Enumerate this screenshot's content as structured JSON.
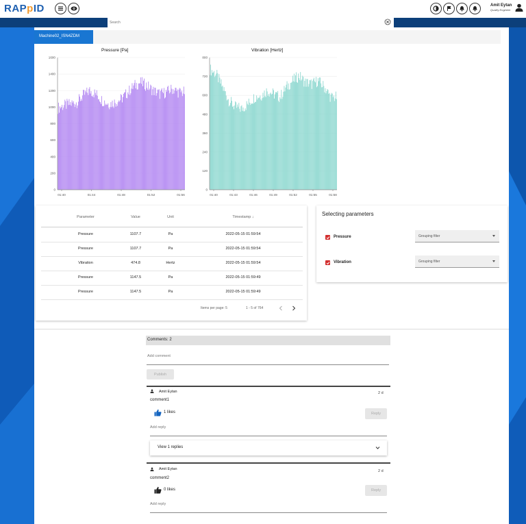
{
  "app": {
    "logo_main": "RAP",
    "logo_accent": "p",
    "logo_tail": "ID",
    "user_name": "Amit Eytan",
    "user_role": "Quality Engineer"
  },
  "icons": {
    "menu": "menu-icon",
    "visibility": "eye-icon",
    "theme": "contrast-icon",
    "flag": "flag-icon",
    "alert": "alert-bell-icon",
    "notifications": "bell-icon",
    "user": "person-icon"
  },
  "search": {
    "placeholder": "Search"
  },
  "tabs": [
    {
      "label": "Machine02_ISN4ZDM"
    }
  ],
  "charts": [
    {
      "title": "Pressure [Pa]",
      "color": "#b388f2",
      "y_ticks": [
        "0",
        "200",
        "400",
        "600",
        "800",
        "1000",
        "1200",
        "1400",
        "1600"
      ],
      "x_ticks": [
        "01:40",
        "01:44",
        "01:48",
        "01:52",
        "01:56"
      ]
    },
    {
      "title": "Vibration [Hertz]",
      "color": "#8ed8d0",
      "y_ticks": [
        "0",
        "120",
        "240",
        "360",
        "480",
        "600",
        "720",
        "800"
      ],
      "x_ticks": [
        "01:40",
        "01:43",
        "01:46",
        "01:49",
        "01:52",
        "01:55",
        "01:58"
      ]
    }
  ],
  "chart_data": [
    {
      "type": "bar",
      "title": "Pressure [Pa]",
      "xlabel": "",
      "ylabel": "",
      "ylim": [
        0,
        1600
      ],
      "x": [
        "01:40",
        "01:41",
        "01:42",
        "01:43",
        "01:44",
        "01:45",
        "01:46",
        "01:47",
        "01:48",
        "01:49",
        "01:50",
        "01:51",
        "01:52",
        "01:53",
        "01:54",
        "01:55",
        "01:56",
        "01:57",
        "01:58",
        "01:59"
      ],
      "values": [
        990,
        1020,
        1040,
        1060,
        1140,
        1200,
        1160,
        1080,
        1040,
        1060,
        1100,
        1180,
        1260,
        1300,
        1260,
        1200,
        1160,
        1180,
        1220,
        1180
      ]
    },
    {
      "type": "bar",
      "title": "Vibration [Hertz]",
      "xlabel": "",
      "ylabel": "",
      "ylim": [
        0,
        800
      ],
      "x": [
        "01:40",
        "01:41",
        "01:42",
        "01:43",
        "01:44",
        "01:45",
        "01:46",
        "01:47",
        "01:48",
        "01:49",
        "01:50",
        "01:51",
        "01:52",
        "01:53",
        "01:54",
        "01:55",
        "01:56",
        "01:57",
        "01:58",
        "01:59"
      ],
      "values": [
        730,
        700,
        620,
        540,
        500,
        490,
        520,
        560,
        570,
        600,
        580,
        560,
        620,
        660,
        690,
        650,
        640,
        660,
        620,
        560
      ]
    }
  ],
  "table": {
    "headers": [
      "Parameter",
      "Value",
      "Unit",
      "Timestamp ↓"
    ],
    "rows": [
      [
        "Pressure",
        "1107.7",
        "Pa",
        "2022-05-15 01:59:54"
      ],
      [
        "Pressure",
        "1107.7",
        "Pa",
        "2022-05-15 01:59:54"
      ],
      [
        "Vibration",
        "474.8",
        "Hertz",
        "2022-05-15 01:59:54"
      ],
      [
        "Pressure",
        "1147.5",
        "Pa",
        "2022-05-15 01:59:49"
      ],
      [
        "Pressure",
        "1147.5",
        "Pa",
        "2022-05-15 01:59:49"
      ]
    ],
    "items_per_page_label": "Items per page: 5",
    "range_label": "1 - 5 of 764"
  },
  "selecting": {
    "title": "Selecting parameters",
    "params": [
      {
        "label": "Pressure",
        "checked": true,
        "filter_placeholder": "Grouping filter"
      },
      {
        "label": "Vibration",
        "checked": true,
        "filter_placeholder": "Grouping filter"
      }
    ]
  },
  "comments": {
    "header": "Comments: 2",
    "add_comment_label": "Add comment",
    "publish_label": "Publish",
    "items": [
      {
        "author": "Amit Eytan",
        "time": "2 d",
        "text": "comment1",
        "likes": "1 likes",
        "reply_label": "Reply",
        "add_reply_label": "Add reply",
        "view_replies": "View 1 replies"
      },
      {
        "author": "Amit Eytan",
        "time": "2 d",
        "text": "comment2",
        "likes": "0 likes",
        "reply_label": "Reply",
        "add_reply_label": "Add reply"
      }
    ]
  }
}
